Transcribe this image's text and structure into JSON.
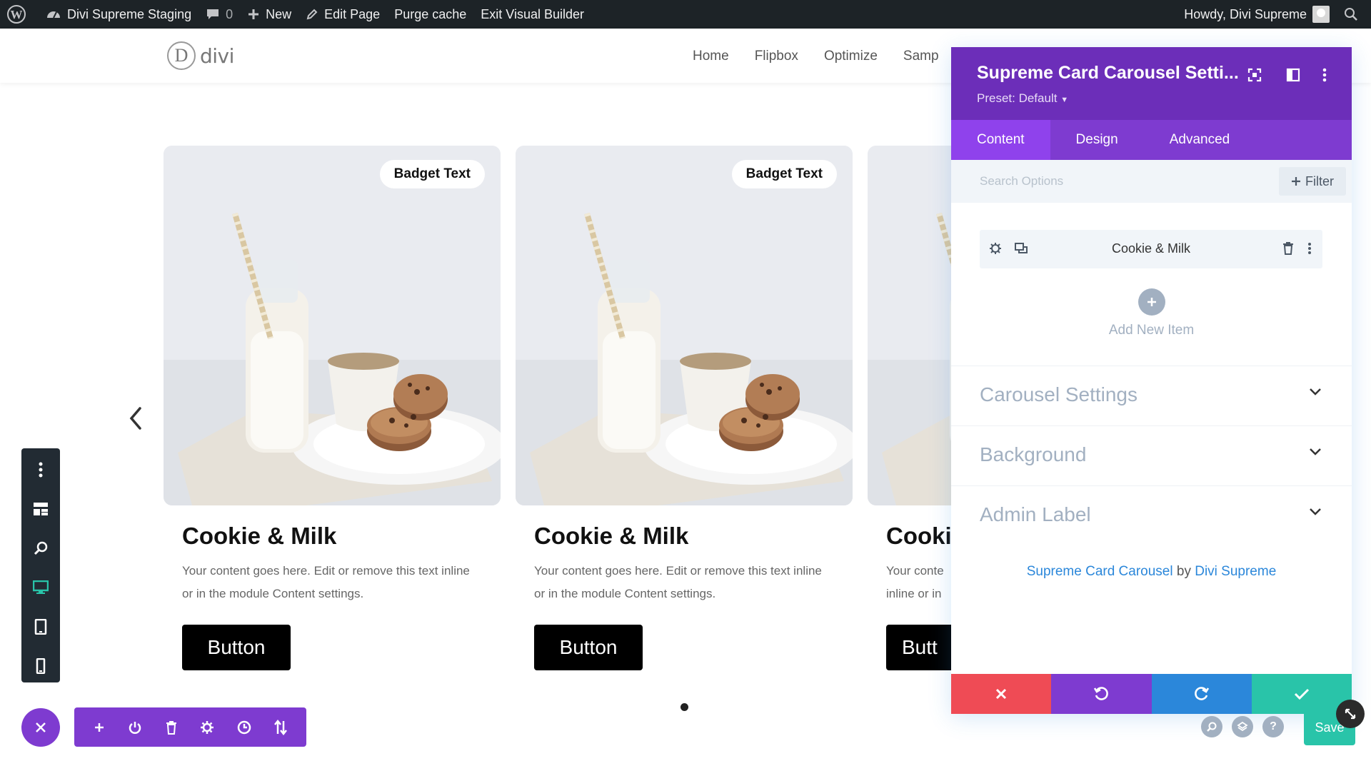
{
  "admin_bar": {
    "site_name": "Divi Supreme Staging",
    "comments_count": "0",
    "new_label": "New",
    "edit_page_label": "Edit Page",
    "purge_cache_label": "Purge cache",
    "exit_builder_label": "Exit Visual Builder",
    "howdy_label": "Howdy, Divi Supreme"
  },
  "site": {
    "logo_letter": "D",
    "logo_text": "divi",
    "nav": [
      "Home",
      "Flipbox",
      "Optimize",
      "Samp"
    ]
  },
  "cards": [
    {
      "badge": "Badget Text",
      "title": "Cookie & Milk",
      "text": "Your content goes here. Edit or remove this text inline or in the module Content settings.",
      "button": "Button"
    },
    {
      "badge": "Badget Text",
      "title": "Cookie & Milk",
      "text": "Your content goes here. Edit or remove this text inline or in the module Content settings.",
      "button": "Button"
    },
    {
      "title": "Cooki",
      "text": "Your conte inline or in",
      "button": "Butt"
    }
  ],
  "panel": {
    "title": "Supreme Card Carousel Setti...",
    "preset": "Preset: Default",
    "tabs": [
      "Content",
      "Design",
      "Advanced"
    ],
    "active_tab": "Content",
    "search_placeholder": "Search Options",
    "filter_label": "Filter",
    "item_label": "Cookie & Milk",
    "add_item_label": "Add New Item",
    "sections": [
      "Carousel Settings",
      "Background",
      "Admin Label"
    ],
    "credit": {
      "module": "Supreme Card Carousel",
      "by": "by",
      "author": "Divi Supreme"
    }
  },
  "save_label": "Save",
  "colors": {
    "admin_bar": "#1d2327",
    "panel_header": "#6c2eb9",
    "panel_tabs": "#7e3bd0",
    "footer_cancel": "#ef4b55",
    "footer_undo": "#7e3bd0",
    "footer_redo": "#2b87da",
    "footer_save": "#29c4a9"
  }
}
